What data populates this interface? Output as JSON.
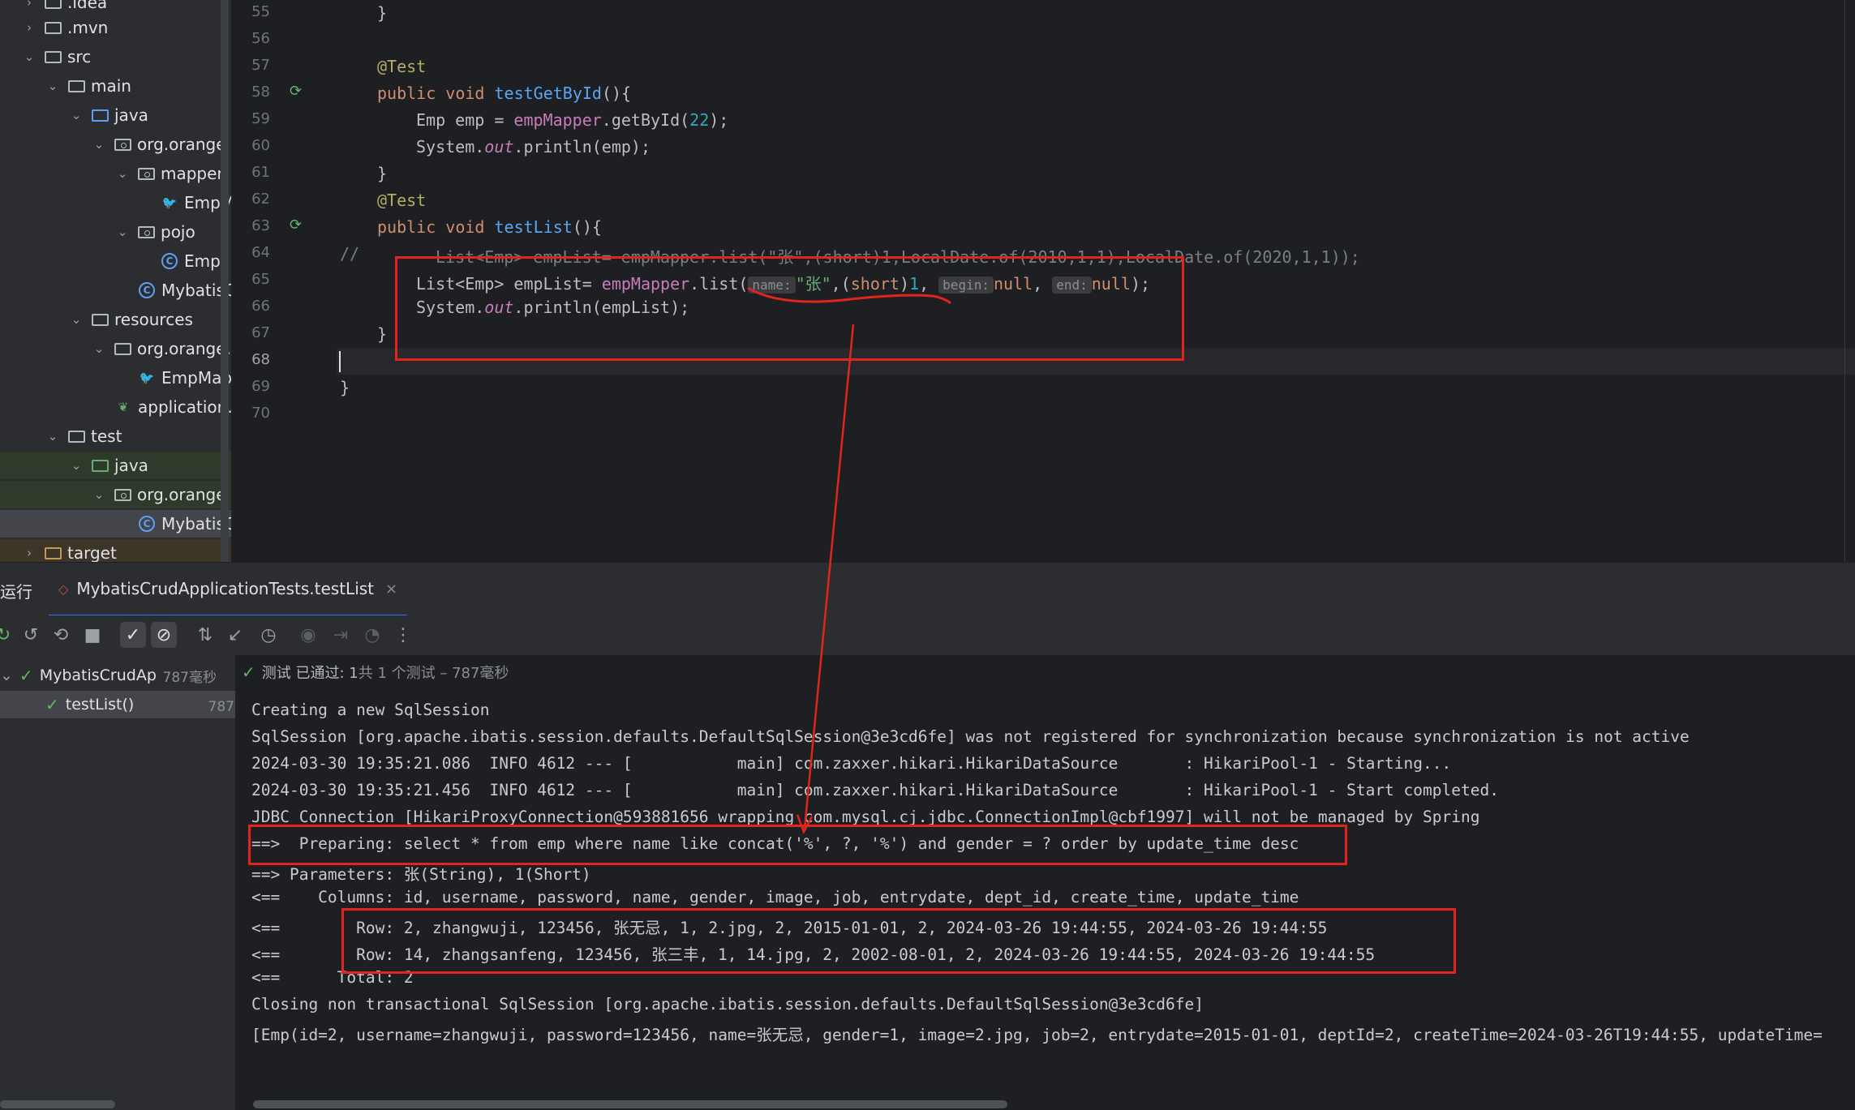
{
  "tree": {
    "items": [
      {
        "label": ".idea",
        "kind": "folder"
      },
      {
        "label": ".mvn",
        "kind": "folder"
      },
      {
        "label": "src",
        "kind": "folder"
      },
      {
        "label": "main",
        "kind": "folder"
      },
      {
        "label": "java",
        "kind": "folder-source"
      },
      {
        "label": "org.orange",
        "kind": "package"
      },
      {
        "label": "mapper",
        "kind": "package"
      },
      {
        "label": "EmpM",
        "kind": "mapper-interface"
      },
      {
        "label": "pojo",
        "kind": "package"
      },
      {
        "label": "Emp",
        "kind": "class"
      },
      {
        "label": "MybatisC",
        "kind": "class"
      },
      {
        "label": "resources",
        "kind": "folder"
      },
      {
        "label": "org.orange.n",
        "kind": "folder"
      },
      {
        "label": "EmpMapp",
        "kind": "xml"
      },
      {
        "label": "application.p",
        "kind": "properties"
      },
      {
        "label": "test",
        "kind": "folder"
      },
      {
        "label": "java",
        "kind": "folder-test"
      },
      {
        "label": "org.orange",
        "kind": "package"
      },
      {
        "label": "MybatisC",
        "kind": "class"
      },
      {
        "label": "target",
        "kind": "folder"
      }
    ]
  },
  "editor": {
    "line_numbers": [
      "55",
      "56",
      "57",
      "58",
      "59",
      "60",
      "61",
      "62",
      "63",
      "64",
      "65",
      "66",
      "67",
      "68",
      "69",
      "70"
    ],
    "current_line": "68",
    "code": {
      "l55": "}",
      "l57": "@Test",
      "l58_kw": "public void ",
      "l58_fn": "testGetById",
      "l58_rest": "(){",
      "l59_a": "Emp emp = ",
      "l59_fld": "empMapper",
      "l59_b": ".getById(",
      "l59_num": "22",
      "l59_c": ");",
      "l60_a": "System.",
      "l60_it": "out",
      "l60_b": ".println(emp);",
      "l61": "}",
      "l62": "@Test",
      "l63_kw": "public void ",
      "l63_fn": "testList",
      "l63_rest": "(){",
      "l64_slashes": "//",
      "l64_comment": "List<Emp> empList= empMapper.list(\"张\",(short)1,LocalDate.of(2010,1,1),LocalDate.of(2020,1,1));",
      "l65_a": "List<Emp> empList= ",
      "l65_fld": "empMapper",
      "l65_b": ".list(",
      "l65_hint_name": "name:",
      "l65_str": "\"张\"",
      "l65_c": ",(",
      "l65_kw": "short",
      "l65_d": ")",
      "l65_num": "1",
      "l65_e": ", ",
      "l65_hint_begin": "begin:",
      "l65_null1": "null",
      "l65_f": ", ",
      "l65_hint_end": "end:",
      "l65_null2": "null",
      "l65_g": ");",
      "l66_a": "System.",
      "l66_it": "out",
      "l66_b": ".println(empList);",
      "l67": "}",
      "l69": "}"
    }
  },
  "run": {
    "label": "运行",
    "tab_title": "MybatisCrudApplicationTests.testList",
    "tab_close": "×",
    "status_passed": "测试 已通过: 1",
    "status_total": "共 1 个测试 – 787毫秒",
    "test_tree": [
      {
        "label": "MybatisCrudAp",
        "duration": "787毫秒"
      },
      {
        "label": "testList()",
        "duration": "787毫秒"
      }
    ],
    "console_lines": [
      "Creating a new SqlSession",
      "SqlSession [org.apache.ibatis.session.defaults.DefaultSqlSession@3e3cd6fe] was not registered for synchronization because synchronization is not active",
      "2024-03-30 19:35:21.086  INFO 4612 --- [           main] com.zaxxer.hikari.HikariDataSource       : HikariPool-1 - Starting...",
      "2024-03-30 19:35:21.456  INFO 4612 --- [           main] com.zaxxer.hikari.HikariDataSource       : HikariPool-1 - Start completed.",
      "JDBC Connection [HikariProxyConnection@593881656 wrapping com.mysql.cj.jdbc.ConnectionImpl@cbf1997] will not be managed by Spring",
      "==>  Preparing: select * from emp where name like concat('%', ?, '%') and gender = ? order by update_time desc",
      "==> Parameters: 张(String), 1(Short)",
      "<==    Columns: id, username, password, name, gender, image, job, entrydate, dept_id, create_time, update_time",
      "<==        Row: 2, zhangwuji, 123456, 张无忌, 1, 2.jpg, 2, 2015-01-01, 2, 2024-03-26 19:44:55, 2024-03-26 19:44:55",
      "<==        Row: 14, zhangsanfeng, 123456, 张三丰, 1, 14.jpg, 2, 2002-08-01, 2, 2024-03-26 19:44:55, 2024-03-26 19:44:55",
      "<==      Total: 2",
      "Closing non transactional SqlSession [org.apache.ibatis.session.defaults.DefaultSqlSession@3e3cd6fe]",
      "[Emp(id=2, username=zhangwuji, password=123456, name=张无忌, gender=1, image=2.jpg, job=2, entrydate=2015-01-01, deptId=2, createTime=2024-03-26T19:44:55, updateTime="
    ]
  },
  "colors": {
    "annotation_red": "#e1251b",
    "pass_green": "#5fb865"
  }
}
